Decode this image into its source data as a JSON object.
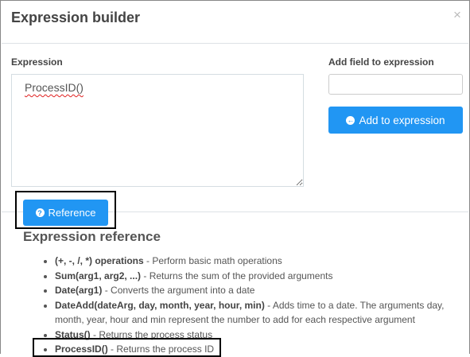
{
  "dialog": {
    "title": "Expression builder",
    "close_label": "×"
  },
  "expression": {
    "label": "Expression",
    "value": "ProcessID()"
  },
  "add_field": {
    "label": "Add field to expression",
    "value": "",
    "button_label": "Add to expression",
    "button_icon": "arrow-circle-left-icon"
  },
  "reference_button": {
    "label": "Reference",
    "icon": "question-circle-icon"
  },
  "reference": {
    "heading": "Expression reference",
    "items": [
      {
        "name": "(+, -, /, *) operations",
        "desc": " - Perform basic math operations"
      },
      {
        "name": "Sum(arg1, arg2, ...)",
        "desc": " - Returns the sum of the provided arguments"
      },
      {
        "name": "Date(arg1)",
        "desc": " - Converts the argument into a date"
      },
      {
        "name": "DateAdd(dateArg, day, month, year, hour, min)",
        "desc": " - Adds time to a date. The arguments day, month, year, hour and min represent the number to add for each respective argument"
      },
      {
        "name": "Status()",
        "desc": " - Returns the process status"
      },
      {
        "name": "ProcessID()",
        "desc": " - Returns the process ID"
      }
    ]
  },
  "colors": {
    "primary": "#2196f3"
  }
}
